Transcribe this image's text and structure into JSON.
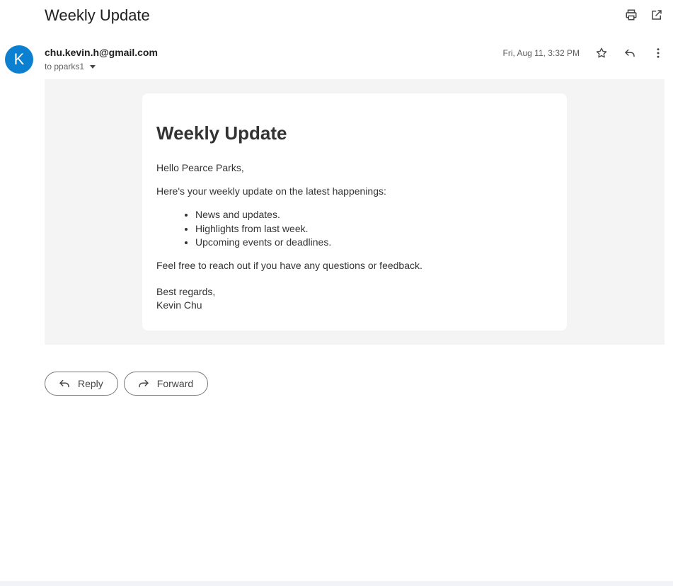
{
  "email": {
    "subject": "Weekly Update",
    "sender": "chu.kevin.h@gmail.com",
    "avatar_initial": "K",
    "recipient_label": "to pparks1",
    "date": "Fri, Aug 11, 3:32 PM"
  },
  "icons": {
    "print": "print-icon",
    "open_new_window": "open-in-new-icon",
    "star": "star-icon",
    "reply": "reply-icon",
    "more": "more-vert-icon",
    "dropdown": "chevron-down-icon",
    "forward": "forward-icon"
  },
  "content": {
    "heading": "Weekly Update",
    "greeting": "Hello Pearce Parks,",
    "intro": "Here's your weekly update on the latest happenings:",
    "bullets": [
      "News and updates.",
      "Highlights from last week.",
      "Upcoming events or deadlines."
    ],
    "closing": "Feel free to reach out if you have any questions or feedback.",
    "signoff": "Best regards,",
    "signature": "Kevin Chu"
  },
  "actions": {
    "reply_label": "Reply",
    "forward_label": "Forward"
  },
  "colors": {
    "avatar": "#0b7fd0",
    "body_background": "#f4f4f4"
  }
}
